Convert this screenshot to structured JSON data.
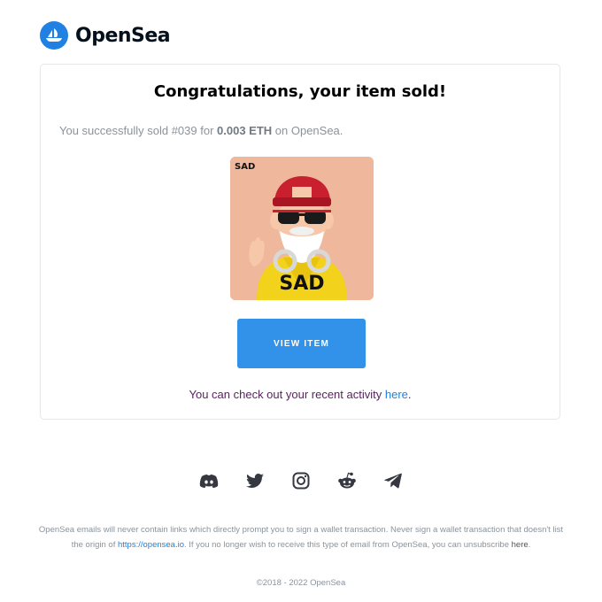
{
  "header": {
    "brand": "OpenSea",
    "logo_icon": "opensea-boat-logo",
    "brand_color": "#2081e2"
  },
  "card": {
    "title": "Congratulations, your item sold!",
    "sold_prefix": "You successfully sold #039 for ",
    "sold_amount": "0.003 ETH",
    "sold_suffix": " on OpenSea.",
    "nft_label": "SAD",
    "nft_badge": "SAD",
    "view_button": "VIEW ITEM",
    "activity_prefix": "You can check out your recent activity ",
    "activity_link": "here",
    "activity_suffix": ".",
    "button_color": "#3291e9"
  },
  "socials": [
    {
      "icon": "discord-icon"
    },
    {
      "icon": "twitter-icon"
    },
    {
      "icon": "instagram-icon"
    },
    {
      "icon": "reddit-icon"
    },
    {
      "icon": "telegram-icon"
    }
  ],
  "footer": {
    "disclaimer_1": "OpenSea emails will never contain links which directly prompt you to sign a wallet transaction. Never sign a wallet transaction that doesn't list the origin of ",
    "disclaimer_url": "https://opensea.io",
    "disclaimer_2": ". If you no longer wish to receive this type of email from OpenSea, you can unsubscribe ",
    "unsubscribe_link": "here",
    "disclaimer_3": ".",
    "copyright": "©2018 - 2022 OpenSea"
  }
}
